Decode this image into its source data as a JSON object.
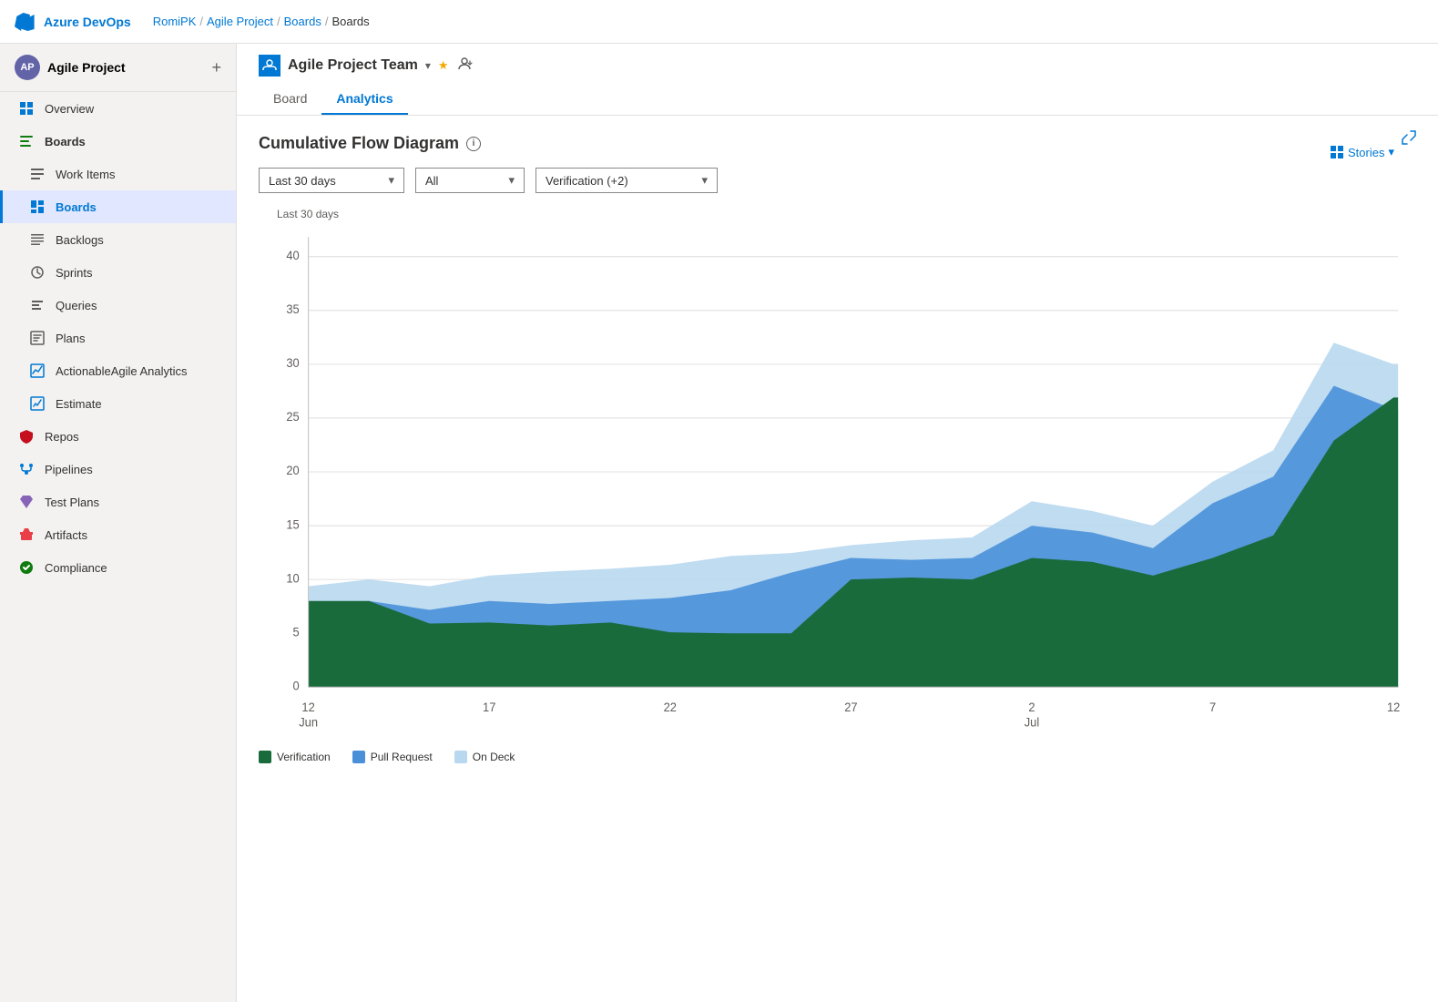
{
  "topbar": {
    "logo_text": "Azure DevOps",
    "breadcrumb": [
      "RomiPK",
      "Agile Project",
      "Boards",
      "Boards"
    ]
  },
  "sidebar": {
    "project_name": "Agile Project",
    "project_avatar": "AP",
    "nav_items": [
      {
        "id": "overview",
        "label": "Overview",
        "icon": "overview",
        "active": false
      },
      {
        "id": "boards-group",
        "label": "Boards",
        "icon": "boards-group",
        "active": false
      },
      {
        "id": "work-items",
        "label": "Work Items",
        "icon": "work-items",
        "active": false
      },
      {
        "id": "boards",
        "label": "Boards",
        "icon": "boards",
        "active": true
      },
      {
        "id": "backlogs",
        "label": "Backlogs",
        "icon": "backlogs",
        "active": false
      },
      {
        "id": "sprints",
        "label": "Sprints",
        "icon": "sprints",
        "active": false
      },
      {
        "id": "queries",
        "label": "Queries",
        "icon": "queries",
        "active": false
      },
      {
        "id": "plans",
        "label": "Plans",
        "icon": "plans",
        "active": false
      },
      {
        "id": "actionable-agile",
        "label": "ActionableAgile Analytics",
        "icon": "actionable-agile",
        "active": false
      },
      {
        "id": "estimate",
        "label": "Estimate",
        "icon": "estimate",
        "active": false
      },
      {
        "id": "repos",
        "label": "Repos",
        "icon": "repos",
        "active": false
      },
      {
        "id": "pipelines",
        "label": "Pipelines",
        "icon": "pipelines",
        "active": false
      },
      {
        "id": "test-plans",
        "label": "Test Plans",
        "icon": "test-plans",
        "active": false
      },
      {
        "id": "artifacts",
        "label": "Artifacts",
        "icon": "artifacts",
        "active": false
      },
      {
        "id": "compliance",
        "label": "Compliance",
        "icon": "compliance",
        "active": false
      }
    ]
  },
  "page": {
    "team_name": "Agile Project Team",
    "tabs": [
      {
        "id": "board",
        "label": "Board",
        "active": false
      },
      {
        "id": "analytics",
        "label": "Analytics",
        "active": true
      }
    ],
    "stories_label": "Stories",
    "chart_title": "Cumulative Flow Diagram",
    "period_filter": "Last 30 days",
    "type_filter": "All",
    "state_filter": "Verification (+2)",
    "period_label": "Last 30 days",
    "x_labels": [
      "12\nJun",
      "17",
      "22",
      "27",
      "2\nJul",
      "7",
      "12"
    ],
    "y_labels": [
      "0",
      "5",
      "10",
      "15",
      "20",
      "25",
      "30",
      "35",
      "40"
    ],
    "legend": [
      {
        "label": "Verification",
        "color": "#1a6b3c"
      },
      {
        "label": "Pull Request",
        "color": "#4a90d9"
      },
      {
        "label": "On Deck",
        "color": "#b8d8f0"
      }
    ]
  }
}
